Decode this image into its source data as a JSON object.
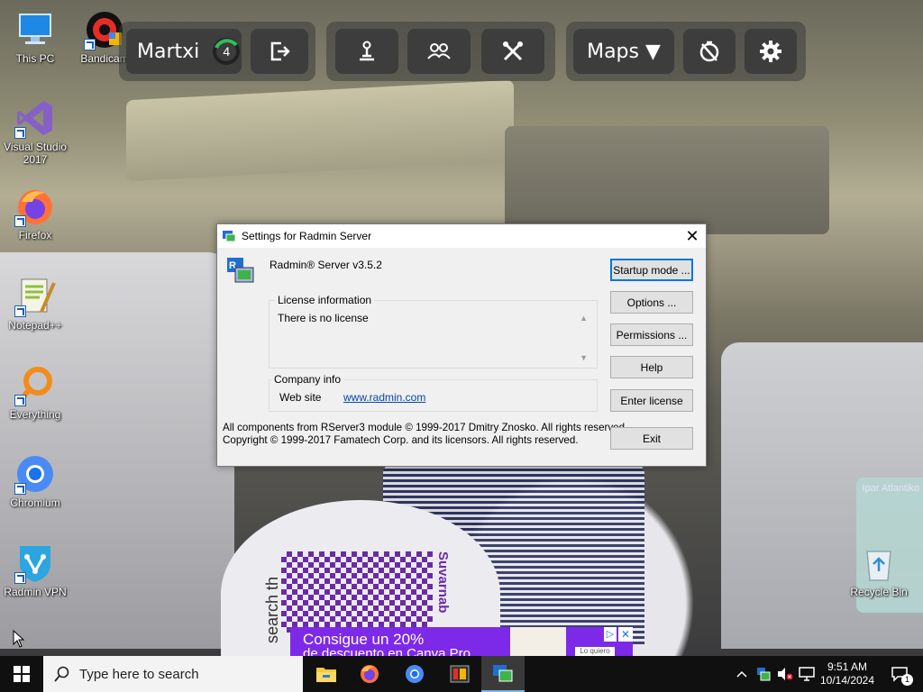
{
  "desktop": {
    "icons": [
      {
        "label": "This PC",
        "icon": "computer-icon"
      },
      {
        "label": "Bandicam",
        "icon": "bandicam-icon"
      },
      {
        "label": "Visual Studio 2017",
        "icon": "visual-studio-icon"
      },
      {
        "label": "Firefox",
        "icon": "firefox-icon"
      },
      {
        "label": "Notepad++",
        "icon": "notepad-plus-plus-icon"
      },
      {
        "label": "Everything",
        "icon": "everything-search-icon"
      },
      {
        "label": "Chromium",
        "icon": "chromium-icon"
      },
      {
        "label": "Radmin VPN",
        "icon": "radmin-vpn-icon"
      },
      {
        "label": "Recycle Bin",
        "icon": "recycle-bin-icon"
      }
    ],
    "background": {
      "qr_text": "Suvarnab",
      "search_text": "search th",
      "tag_text": "Ipar Atlantiko"
    }
  },
  "overlay_toolbar": {
    "user_name": "Martxi",
    "counter": "4",
    "maps_label": "Maps ▼",
    "buttons": [
      "exit-icon",
      "person-pin-icon",
      "group-icon",
      "crossed-tools-icon",
      "no-timer-icon",
      "gear-icon"
    ]
  },
  "dialog": {
    "title": "Settings for Radmin Server",
    "product": "Radmin® Server v3.5.2",
    "license_group_title": "License information",
    "license_text": "There is no license",
    "company_group_title": "Company info",
    "website_label": "Web site",
    "website_link": "www.radmin.com",
    "copyright_line1": "All components from RServer3 module © 1999-2017 Dmitry Znosko. All rights reserved.",
    "copyright_line2": "Copyright © 1999-2017 Famatech Corp. and its licensors. All rights reserved.",
    "buttons": {
      "startup_mode": "Startup mode ...",
      "options": "Options ...",
      "permissions": "Permissions ...",
      "help": "Help",
      "enter_license": "Enter license",
      "exit": "Exit"
    },
    "close_glyph": "✕"
  },
  "ad": {
    "line1": "Consigue un 20%",
    "line2": "de descuento en Canva Pro",
    "button": "Lo quiero",
    "close": "✕",
    "choices": "▷"
  },
  "taskbar": {
    "search_placeholder": "Type here to search",
    "apps": [
      "file-explorer-icon",
      "firefox-icon",
      "chromium-icon",
      "bandicam-taskbar-icon",
      "radmin-server-icon"
    ],
    "time": "9:51 AM",
    "date": "10/14/2024",
    "notification_count": "1"
  },
  "colors": {
    "taskbar": "#101010",
    "dialog_bg": "#f0f0f0",
    "default_button_border": "#0078d7",
    "link": "#0645ad",
    "ad_purple": "#7d2ae8"
  }
}
